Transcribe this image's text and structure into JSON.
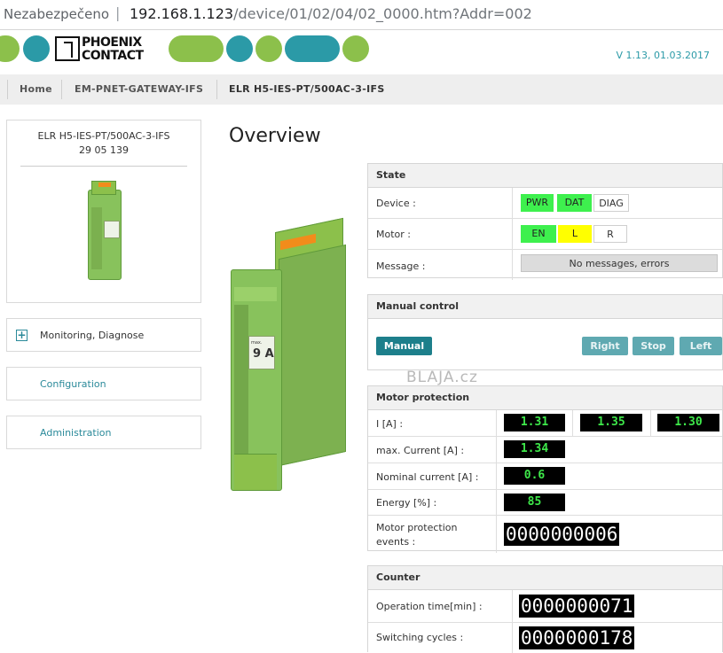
{
  "browser": {
    "security": "Nezabezpečeno",
    "separator": "|",
    "host": "192.168.1.123",
    "path": "/device/01/02/04/02_0000.htm?Addr=002"
  },
  "brand": {
    "logo_line1": "PHOENIX",
    "logo_line2": "CONTACT",
    "version": "V 1.13, 01.03.2017",
    "colors": {
      "green": "#8cc04b",
      "teal": "#2b9aa7"
    }
  },
  "breadcrumb": [
    "Home",
    "EM-PNET-GATEWAY-IFS",
    "ELR H5-IES-PT/500AC-3-IFS"
  ],
  "sidebar": {
    "device_name": "ELR H5-IES-PT/500AC-3-IFS",
    "device_number": "29 05 139",
    "nav": [
      {
        "label": "Monitoring, Diagnose",
        "icon": "plus-icon"
      },
      {
        "label": "Configuration"
      },
      {
        "label": "Administration"
      }
    ]
  },
  "page_title": "Overview",
  "product_image_text": {
    "rating": "9 A",
    "rating_prefix": "max."
  },
  "state": {
    "title": "State",
    "device_label": "Device :",
    "device_leds": [
      {
        "label": "PWR",
        "state": "on-green"
      },
      {
        "label": "DAT",
        "state": "on-green"
      },
      {
        "label": "DIAG",
        "state": "off"
      }
    ],
    "motor_label": "Motor :",
    "motor_leds": [
      {
        "label": "EN",
        "state": "on-green"
      },
      {
        "label": "L",
        "state": "on-yellow"
      },
      {
        "label": "R",
        "state": "off"
      }
    ],
    "message_label": "Message :",
    "message_value": "No messages, errors"
  },
  "manual_control": {
    "title": "Manual control",
    "manual_label": "Manual",
    "right_label": "Right",
    "stop_label": "Stop",
    "left_label": "Left"
  },
  "watermark": "BLAJA.cz",
  "motor_protection": {
    "title": "Motor protection",
    "current_label": "I [A] :",
    "current_values": [
      "1.31",
      "1.35",
      "1.30"
    ],
    "max_current_label": "max. Current [A] :",
    "max_current_value": "1.34",
    "nominal_label": "Nominal current [A] :",
    "nominal_value": "0.6",
    "energy_label": "Energy [%] :",
    "energy_value": "85",
    "events_label_line1": "Motor protection",
    "events_label_line2": "events :",
    "events_value": "0000000006"
  },
  "counter": {
    "title": "Counter",
    "operation_label": "Operation time[min] :",
    "operation_value": "0000000071",
    "switching_label": "Switching cycles :",
    "switching_value": "0000000178"
  }
}
